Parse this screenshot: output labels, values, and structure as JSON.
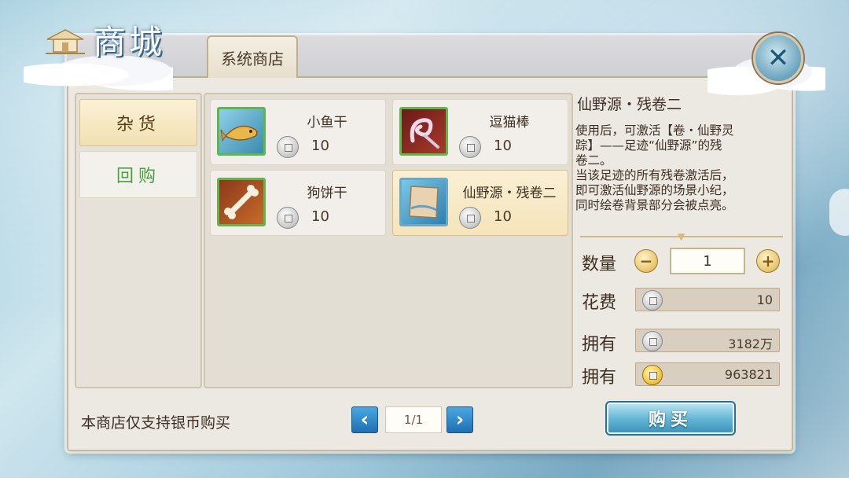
{
  "header": {
    "title": "商城",
    "tab_label": "系统商店"
  },
  "sidebar": {
    "items": [
      {
        "label": "杂货",
        "active": true
      },
      {
        "label": "回购",
        "active": false
      }
    ]
  },
  "items": [
    {
      "name": "小鱼干",
      "price": "10",
      "icon": "dried-fish-icon"
    },
    {
      "name": "逗猫棒",
      "price": "10",
      "icon": "cat-teaser-icon"
    },
    {
      "name": "狗饼干",
      "price": "10",
      "icon": "dog-biscuit-bone-icon"
    },
    {
      "name": "仙野源・残卷二",
      "price": "10",
      "icon": "scroll-fragment-icon",
      "selected": true
    }
  ],
  "detail": {
    "title": "仙野源・残卷二",
    "description": "使用后，可激活【卷・仙野灵\n踪】——足迹“仙野源”的残\n卷二。\n当该足迹的所有残卷激活后，\n即可激活仙野源的场景小纪，\n同时绘卷背景部分会被点亮。"
  },
  "purchase": {
    "quantity_label": "数量",
    "quantity": "1",
    "cost_label": "花费",
    "cost": "10",
    "owned_label_1": "拥有",
    "owned_silver": "3182万",
    "owned_label_2": "拥有",
    "owned_gold": "963821",
    "buy_label": "购买"
  },
  "footer": {
    "notice": "本商店仅支持银币购买",
    "page": "1/1"
  },
  "colors": {
    "accent_blue": "#1f6fb3",
    "selected_item": "#f5e4bb",
    "item_border_green": "#5fb64a",
    "recall_green": "#4aa040"
  }
}
